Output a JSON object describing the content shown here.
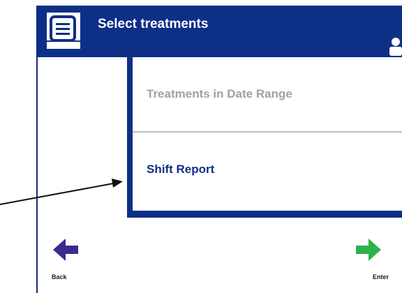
{
  "header": {
    "title": "Select treatments",
    "menu_icon": "list-icon",
    "user_icon": "user-icon",
    "background_color": "#0e2f86"
  },
  "options": [
    {
      "label": "Treatments in Date Range",
      "state": "disabled",
      "color": "#9ea3a8"
    },
    {
      "label": "Shift Report",
      "state": "enabled",
      "color": "#0e2f86"
    }
  ],
  "navigation": {
    "back": {
      "label": "Back",
      "icon": "arrow-left-icon",
      "color": "#3d2a8f"
    },
    "enter": {
      "label": "Enter",
      "icon": "arrow-right-icon",
      "color": "#2fb24a"
    }
  },
  "callout": {
    "icon": "pointer-arrow-icon"
  }
}
